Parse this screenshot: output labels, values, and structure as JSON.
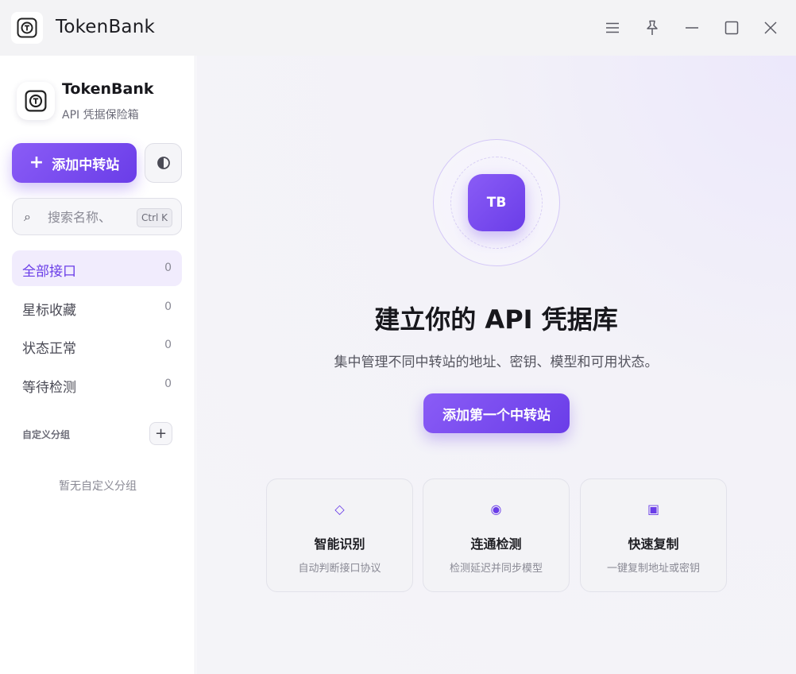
{
  "titlebar": {
    "title": "TokenBank",
    "icons": [
      "app-logo-icon",
      "menu-icon",
      "pin-icon",
      "minimize-icon",
      "maximize-icon",
      "close-icon"
    ]
  },
  "sidebar": {
    "brand_name": "TokenBank",
    "brand_subtitle": "API 凭据保险箱",
    "add_button_label": "添加中转站",
    "search": {
      "placeholder": "搜索名称、",
      "shortcut": "Ctrl K"
    },
    "nav_items": [
      {
        "label": "全部接口",
        "count": "0",
        "active": true
      },
      {
        "label": "星标收藏",
        "count": "0"
      },
      {
        "label": "状态正常",
        "count": "0"
      },
      {
        "label": "等待检测",
        "count": "0"
      }
    ],
    "custom_group_title": "自定义分组",
    "custom_group_empty": "暂无自定义分组"
  },
  "main": {
    "badge_text": "TB",
    "title": "建立你的 API 凭据库",
    "subtitle": "集中管理不同中转站的地址、密钥、模型和可用状态。",
    "cta_label": "添加第一个中转站",
    "features": [
      {
        "icon": "◇",
        "icon_name": "diamond-icon",
        "title": "智能识别",
        "desc": "自动判断接口协议"
      },
      {
        "icon": "◉",
        "icon_name": "target-icon",
        "title": "连通检测",
        "desc": "检测延迟并同步模型"
      },
      {
        "icon": "▣",
        "icon_name": "copy-square-icon",
        "title": "快速复制",
        "desc": "一键复制地址或密钥"
      }
    ]
  },
  "colors": {
    "accent": "#6a3de8",
    "accent_light": "#8a5cf6",
    "active_nav_bg": "#f1ecfd"
  }
}
